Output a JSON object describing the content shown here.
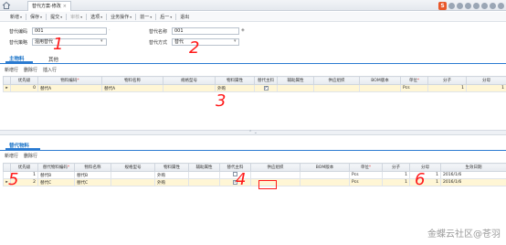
{
  "window": {
    "tab_title": "替代方案-修改",
    "tab_close": "×",
    "brand_glyph": "S"
  },
  "toolbar": {
    "items": [
      {
        "label": "新增",
        "caret": "▾",
        "enabled": true
      },
      {
        "label": "保存",
        "caret": "▾",
        "enabled": true
      },
      {
        "label": "提交",
        "caret": "▾",
        "enabled": true
      },
      {
        "label": "审核",
        "caret": "▾",
        "enabled": false
      },
      {
        "label": "选项",
        "caret": "▾",
        "enabled": true
      },
      {
        "label": "业务操作",
        "caret": "▾",
        "enabled": true
      },
      {
        "label": "前一",
        "caret": "▾",
        "enabled": true
      },
      {
        "label": "后一",
        "caret": "▾",
        "enabled": true
      },
      {
        "label": "退出",
        "caret": "",
        "enabled": true
      }
    ]
  },
  "header_form": {
    "code_label": "替代编码",
    "code_value": "001",
    "strategy_label": "替代策略",
    "strategy_value": "混用替代",
    "name_label": "替代名称",
    "name_value": "001",
    "mode_label": "替代方式",
    "mode_value": "替代"
  },
  "main_section": {
    "tab_active": "主物料",
    "tab_other": "其他",
    "ops": [
      "新增行",
      "删除行",
      "插入行"
    ],
    "columns": [
      "优先级",
      "物料编码",
      "物料名称",
      "规格型号",
      "物料属性",
      "替代主料",
      "辅助属性",
      "供应组织",
      "BOM版本",
      "单位",
      "分子",
      "分母"
    ],
    "required_marks": {
      "物料编码": "*",
      "单位": "*"
    },
    "rows": [
      {
        "sel": "▸",
        "idx": "1",
        "priority": "0",
        "code": "替代A",
        "name": "替代A",
        "spec": "",
        "attr": "外购",
        "is_main": "✓",
        "aux": "",
        "supply_org": "",
        "bom": "",
        "unit": "Pcs",
        "numerator": "1",
        "denominator": "1"
      }
    ]
  },
  "splitter": {
    "glyph": "⌃ ⌄"
  },
  "sub_section": {
    "tab_active": "替代物料",
    "ops": [
      "新增行",
      "删除行"
    ],
    "columns": [
      "优先级",
      "替代物料编码",
      "物料名称",
      "规格型号",
      "物料属性",
      "辅助属性",
      "替代主料",
      "供应组织",
      "BOM版本",
      "单位",
      "分子",
      "分母",
      "生效日期"
    ],
    "required_marks": {
      "替代物料编码": "*",
      "单位": "*"
    },
    "rows": [
      {
        "sel": "",
        "idx": "1",
        "priority": "1",
        "code": "替代B",
        "name": "替代B",
        "spec": "",
        "attr": "外购",
        "aux": "",
        "is_main": "",
        "supply_org": "",
        "bom": "",
        "unit": "Pcs",
        "numerator": "1",
        "denominator": "1",
        "effective": "2016/1/6"
      },
      {
        "sel": "▸",
        "idx": "2",
        "priority": "2",
        "code": "替代C",
        "name": "替代C",
        "spec": "",
        "attr": "外购",
        "aux": "",
        "is_main": "✓",
        "supply_org": "",
        "bom": "",
        "unit": "Pcs",
        "numerator": "1",
        "denominator": "1",
        "effective": "2016/1/6"
      }
    ]
  },
  "annotations": [
    "1",
    "2",
    "3",
    "4",
    "5",
    "6"
  ],
  "watermark": "金蝶云社区@苍羽",
  "colors": {
    "accent": "#2b7bd1",
    "annotation": "#ff1a1a",
    "selected_row": "#fff6d5"
  }
}
